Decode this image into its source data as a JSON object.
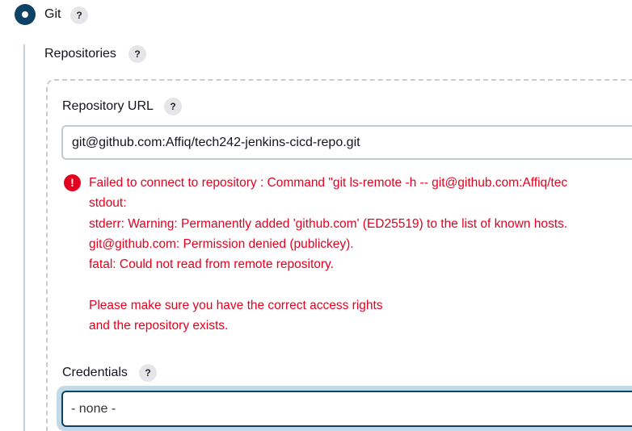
{
  "scm_option": {
    "label": "Git",
    "selected": true,
    "help": "?"
  },
  "repositories": {
    "label": "Repositories",
    "help": "?"
  },
  "repository_url": {
    "label": "Repository URL",
    "help": "?",
    "value": "git@github.com:Affiq/tech242-jenkins-cicd-repo.git"
  },
  "error": {
    "icon": "exclamation-circle-icon",
    "color": "#e6001f",
    "lines": [
      "Failed to connect to repository : Command \"git ls-remote -h -- git@github.com:Affiq/tec",
      "stdout:",
      "stderr: Warning: Permanently added 'github.com' (ED25519) to the list of known hosts.",
      "git@github.com: Permission denied (publickey).",
      "fatal: Could not read from remote repository.",
      "",
      "Please make sure you have the correct access rights",
      "and the repository exists."
    ]
  },
  "credentials": {
    "label": "Credentials",
    "help": "?",
    "value": "- none -"
  },
  "accent_color": "#0b4266"
}
